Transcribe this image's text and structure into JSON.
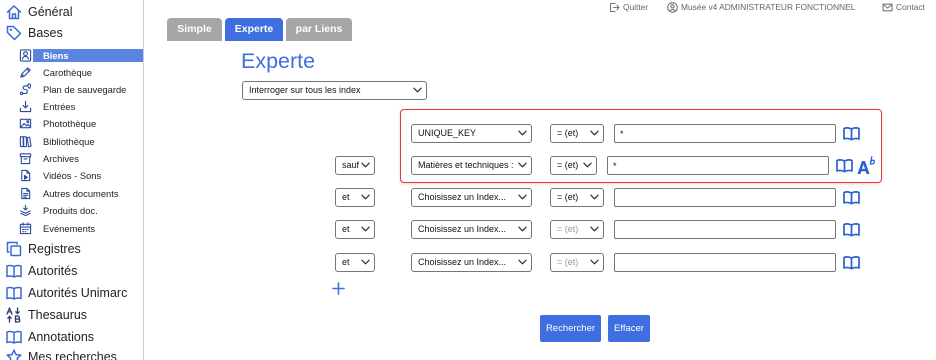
{
  "header": {
    "quit": {
      "label": "Quitter",
      "icon": "logout-icon"
    },
    "user": {
      "label": "Musée v4 ADMINISTRATEUR FONCTIONNEL",
      "icon": "user-circle-icon"
    },
    "contact": {
      "label": "Contact",
      "icon": "mail-icon"
    }
  },
  "sidebar": {
    "general": {
      "label": "Général",
      "icon": "home-icon"
    },
    "bases": {
      "label": "Bases",
      "icon": "tag-icon",
      "items": [
        {
          "label": "Biens",
          "icon": "bust-icon",
          "active": true
        },
        {
          "label": "Carothèque",
          "icon": "pen-tool-icon"
        },
        {
          "label": "Plan de sauvegarde",
          "icon": "route-icon"
        },
        {
          "label": "Entrées",
          "icon": "download-icon"
        },
        {
          "label": "Photothèque",
          "icon": "image-icon"
        },
        {
          "label": "Bibliothèque",
          "icon": "books-icon"
        },
        {
          "label": "Archives",
          "icon": "archive-box-icon"
        },
        {
          "label": "Vidéos - Sons",
          "icon": "video-file-icon"
        },
        {
          "label": "Autres documents",
          "icon": "document-icon"
        },
        {
          "label": "Produits doc.",
          "icon": "stack-icon"
        },
        {
          "label": "Evénements",
          "icon": "calendar-icon"
        }
      ]
    },
    "sections": [
      {
        "label": "Registres",
        "icon": "copy-icon"
      },
      {
        "label": "Autorités",
        "icon": "book-icon"
      },
      {
        "label": "Autorités Unimarc",
        "icon": "book-icon"
      },
      {
        "label": "Thesaurus",
        "icon": "sort-alpha-icon"
      },
      {
        "label": "Annotations",
        "icon": "book-icon"
      },
      {
        "label": "Mes recherches",
        "icon": "star-icon"
      }
    ]
  },
  "tabs": [
    {
      "label": "Simple",
      "active": false
    },
    {
      "label": "Experte",
      "active": true
    },
    {
      "label": "par Liens",
      "active": false
    }
  ],
  "search": {
    "title": "Experte",
    "scope": "Interroger sur tous les index",
    "criteria": [
      {
        "index": "UNIQUE_KEY",
        "operator": "= (et)",
        "value": "*"
      },
      {
        "connector": "sauf",
        "index": "Matières et techniques :",
        "operator": "= (et)",
        "value": "*"
      },
      {
        "connector": "et",
        "index": "Choisissez un Index...",
        "operator": "= (et)",
        "value": ""
      },
      {
        "connector": "et",
        "index": "Choisissez un Index...",
        "operator": "= (et)",
        "value": "",
        "operator_disabled": true
      },
      {
        "connector": "et",
        "index": "Choisissez un Index...",
        "operator": "= (et)",
        "value": "",
        "operator_disabled": true
      }
    ],
    "row_icons": [
      "book-icon",
      "text-format-icon"
    ],
    "add_icon": "plus-icon",
    "buttons": {
      "search": "Rechercher",
      "clear": "Effacer"
    }
  },
  "colors": {
    "accent": "#3f6ee0",
    "tab_inactive": "#a6a6a6",
    "active_item_bg": "#5b84df",
    "highlight_border": "#e03a3a",
    "icon_blue": "#3a68d8"
  }
}
